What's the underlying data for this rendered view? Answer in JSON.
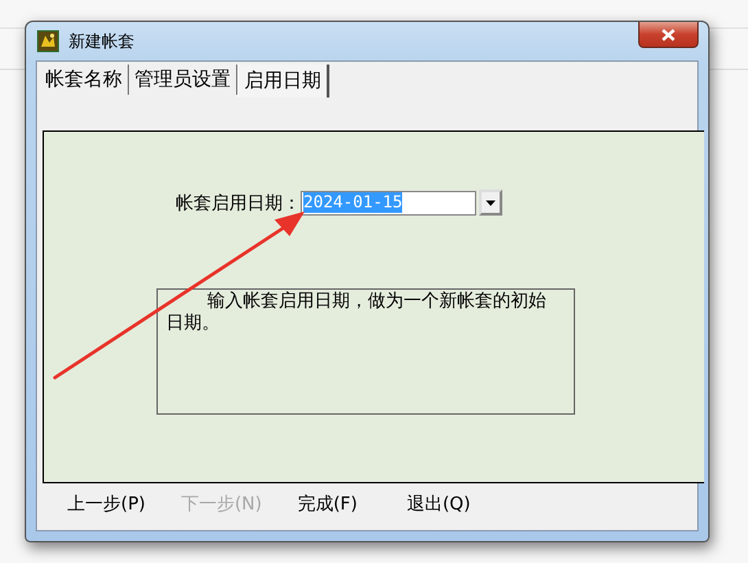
{
  "window": {
    "title": "新建帐套"
  },
  "tabs": [
    {
      "label": "帐套名称",
      "selected": false
    },
    {
      "label": "管理员设置",
      "selected": false
    },
    {
      "label": "启用日期",
      "selected": true
    }
  ],
  "date_field": {
    "label": "帐套启用日期：",
    "value": "2024-01-15"
  },
  "description": "输入帐套启用日期，做为一个新帐套的初始日期。",
  "buttons": [
    {
      "label": "上一步(P)",
      "disabled": false
    },
    {
      "label": "下一步(N)",
      "disabled": true
    },
    {
      "label": "完成(F)",
      "disabled": false
    },
    {
      "label": "退出(Q)",
      "disabled": false
    }
  ]
}
